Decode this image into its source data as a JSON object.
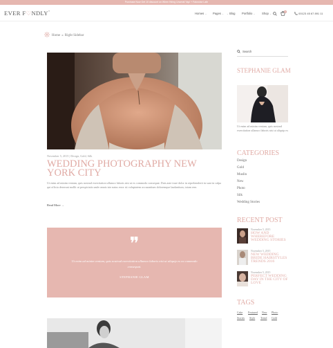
{
  "topbar": {
    "text": "Purchase Now Get 10 discount on When Hiring Uncreat Yapi + Faloroise Lath"
  },
  "header": {
    "logo_left": "EVER F",
    "logo_heart": "♡",
    "logo_right": "NDLY",
    "logo_tm": "®",
    "nav": [
      {
        "label": "Homes",
        "dd": "⌄"
      },
      {
        "label": "Pages",
        "dd": "⌄"
      },
      {
        "label": "Blog",
        "dd": "⌄"
      },
      {
        "label": "Portfolio",
        "dd": "⌄"
      },
      {
        "label": "Shop",
        "dd": "⌄"
      }
    ],
    "cart_count": "0",
    "phone": "00123 45 67 891 11"
  },
  "breadcrumb": {
    "home": "Home",
    "sep": "»",
    "current": "Right Sidebar"
  },
  "post": {
    "meta": "November 5, 2015 | Design, Gold, Silk",
    "title": "WEDDING PHOTOGRAPHY NEW YORK CITY",
    "excerpt": "Ut enim ad minim veniam, quis nostrud exercitation ullamco laboris nisi ut ex commodo consequat. Duis aute irure dolor in reprehenderit in sunt in culpa qui officia deserunt mollit ut perspiciatis unde omnis iste natus error sit voluptatem accusantium doloremque laudantium, totam rem",
    "read_more": "Read More"
  },
  "quote": {
    "mark": "❞",
    "text": "Ut enim ad minim veniam, quis nostrud exercitation ullamco laboris nisi ut aliquip ex ea commodo consequat.",
    "author": "STEPHANIE GLAM"
  },
  "sidebar": {
    "search_placeholder": "Search",
    "about": {
      "name": "STEPHANIE GLAM",
      "text": "Ut enim ad minim veniam, quis nostrud exercitation ullamco laboris nisi ut aliquip ex"
    },
    "categories_title": "CATEGORIES",
    "categories": [
      "Design",
      "Gold",
      "Muslin",
      "New",
      "Photo",
      "Silk",
      "Wedding Stories"
    ],
    "recent_title": "RECENT POST",
    "recent": [
      {
        "date": "November 5, 2015",
        "title": "HOW AND WHEREFORE WEDDING STORIES"
      },
      {
        "date": "November 5, 2015",
        "title": "NEW WEDDING BRIDE HAIRSTYLES TRENDS 2016"
      },
      {
        "date": "November 5, 2015",
        "title": "PERFECT WEDDING DAY IN THE CITY OF LOVE"
      }
    ],
    "tags_title": "TAGS",
    "tags": [
      "Cake",
      "Featured",
      "New",
      "Photo",
      "Stories",
      "Style",
      "Trend",
      "Gold"
    ]
  },
  "colors": {
    "accent": "#e0aaa4",
    "quote_bg": "#e6b7b0",
    "topbar_bg": "#e6b7b0"
  }
}
